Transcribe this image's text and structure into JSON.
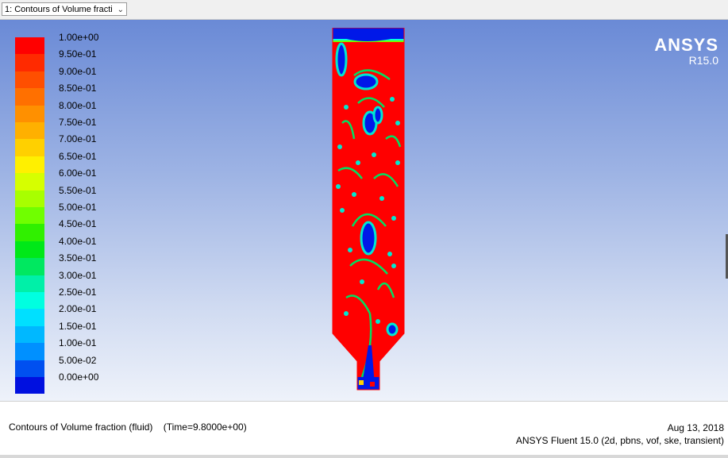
{
  "window": {
    "display_selector": "1: Contours of Volume fractic",
    "chevron_icon": "chevron-down-icon"
  },
  "legend": {
    "labels": [
      "1.00e+00",
      "9.50e-01",
      "9.00e-01",
      "8.50e-01",
      "8.00e-01",
      "7.50e-01",
      "7.00e-01",
      "6.50e-01",
      "6.00e-01",
      "5.50e-01",
      "5.00e-01",
      "4.50e-01",
      "4.00e-01",
      "3.50e-01",
      "3.00e-01",
      "2.50e-01",
      "2.00e-01",
      "1.50e-01",
      "1.00e-01",
      "5.00e-02",
      "0.00e+00"
    ],
    "colors": [
      "#ff0000",
      "#ff2a00",
      "#ff4f00",
      "#ff7000",
      "#ff9000",
      "#ffb000",
      "#ffd000",
      "#fff000",
      "#d6ff00",
      "#a8ff00",
      "#70ff00",
      "#30f000",
      "#00e818",
      "#00e860",
      "#00f0a8",
      "#00ffe0",
      "#00e0ff",
      "#00b8ff",
      "#0090ff",
      "#0050f0",
      "#0010e0"
    ]
  },
  "logo": {
    "name": "ANSYS",
    "version": "R15.0"
  },
  "footer": {
    "title": "Contours of Volume fraction (fluid)    (Time=9.8000e+00)",
    "date": "Aug 13, 2018",
    "solver": "ANSYS Fluent 15.0 (2d, pbns, vof, ske, transient)"
  }
}
